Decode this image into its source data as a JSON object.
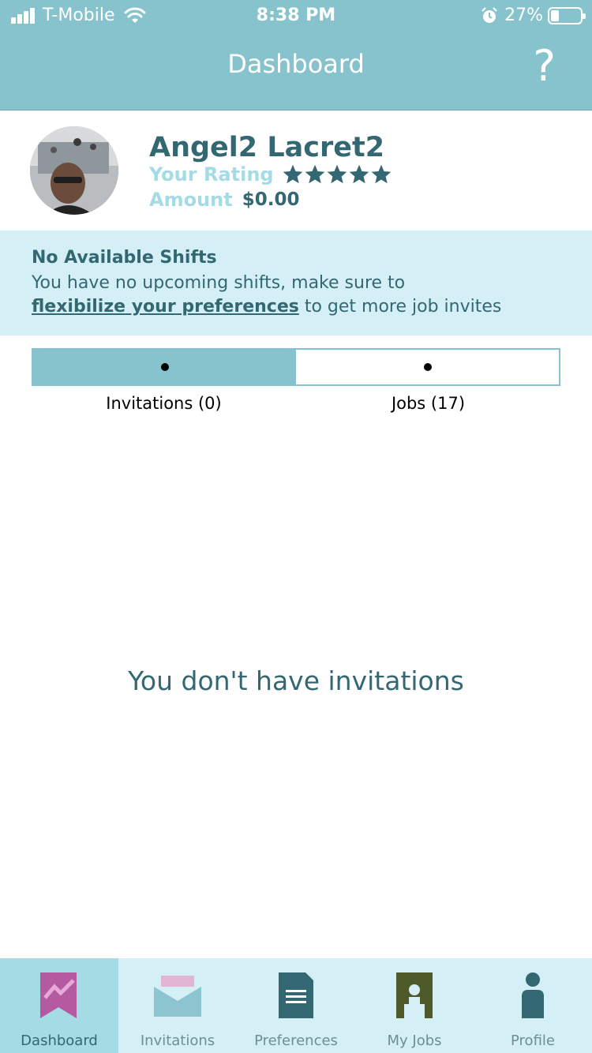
{
  "status_bar": {
    "carrier": "T-Mobile",
    "time": "8:38 PM",
    "battery": "27%",
    "battery_level": 0.27
  },
  "header": {
    "title": "Dashboard",
    "help_label": "?"
  },
  "profile": {
    "name": "Angel2 Lacret2",
    "rating_label": "Your Rating",
    "rating_stars": 5,
    "amount_label": "Amount",
    "amount_value": "$0.00"
  },
  "alert": {
    "title": "No Available Shifts",
    "text_before": "You have no upcoming shifts, make sure to",
    "link_text": "flexibilize your preferences",
    "text_after": "to get more job invites"
  },
  "tabs": [
    {
      "label": "Invitations (0)",
      "active": true
    },
    {
      "label": "Jobs (17)",
      "active": false
    }
  ],
  "empty_message": "You don't have invitations",
  "bottom_nav": [
    {
      "label": "Dashboard",
      "icon": "dashboard-icon",
      "active": true
    },
    {
      "label": "Invitations",
      "icon": "envelope-icon",
      "active": false
    },
    {
      "label": "Preferences",
      "icon": "document-icon",
      "active": false
    },
    {
      "label": "My Jobs",
      "icon": "jobs-icon",
      "active": false
    },
    {
      "label": "Profile",
      "icon": "profile-icon",
      "active": false
    }
  ],
  "colors": {
    "header": "#87c3cd",
    "alert_bg": "#d4f0f6",
    "text_primary": "#336872",
    "text_muted": "#a5dbe5",
    "nav_active": "#a4dbe5"
  }
}
